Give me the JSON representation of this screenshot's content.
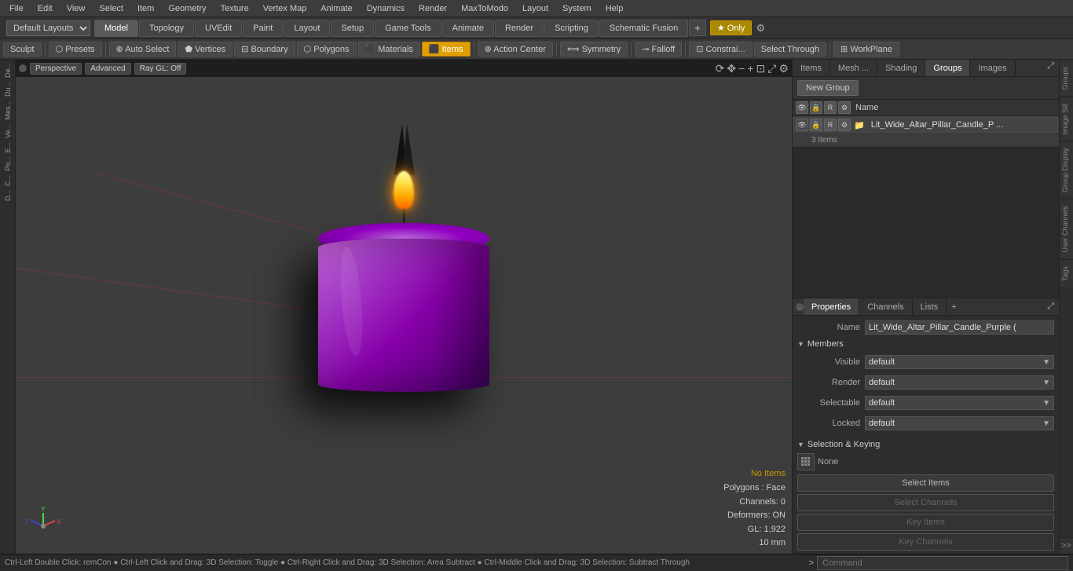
{
  "menubar": {
    "items": [
      "File",
      "Edit",
      "View",
      "Select",
      "Item",
      "Geometry",
      "Texture",
      "Vertex Map",
      "Animate",
      "Dynamics",
      "Render",
      "MaxToModo",
      "Layout",
      "System",
      "Help"
    ]
  },
  "layout_selector": {
    "value": "Default Layouts",
    "label": "Default Layouts ▾"
  },
  "tabs": [
    {
      "label": "Model",
      "active": true
    },
    {
      "label": "Topology",
      "active": false
    },
    {
      "label": "UVEdit",
      "active": false
    },
    {
      "label": "Paint",
      "active": false
    },
    {
      "label": "Layout",
      "active": false
    },
    {
      "label": "Setup",
      "active": false
    },
    {
      "label": "Game Tools",
      "active": false
    },
    {
      "label": "Animate",
      "active": false
    },
    {
      "label": "Render",
      "active": false
    },
    {
      "label": "Scripting",
      "active": false
    },
    {
      "label": "Schematic Fusion",
      "active": false
    }
  ],
  "star_label": "★ Only",
  "plus_label": "+",
  "tools": {
    "sculpt_label": "Sculpt",
    "presets_label": "⬡ Presets",
    "auto_select_label": "⊕ Auto Select",
    "vertices_label": "⬟ Vertices",
    "boundary_label": "⊟ Boundary",
    "polygons_label": "⬡ Polygons",
    "materials_label": "⬛ Materials",
    "items_label": "⬛ Items",
    "action_center_label": "⊕ Action Center",
    "symmetry_label": "⟺ Symmetry",
    "falloff_label": "⊸ Falloff",
    "constraints_label": "⊡ Constrai...",
    "select_through_label": "Select Through",
    "workplane_label": "⊞ WorkPlane"
  },
  "viewport": {
    "mode_label": "Perspective",
    "quality_label": "Advanced",
    "render_label": "Ray GL: Off",
    "status": {
      "no_items": "No Items",
      "polygons": "Polygons : Face",
      "channels": "Channels: 0",
      "deformers": "Deformers: ON",
      "gl": "GL: 1,922",
      "unit": "10 mm"
    }
  },
  "left_sidebar": {
    "items": [
      "De...",
      "Du...",
      "Me...",
      "Ve...",
      "E...",
      "Po...",
      "C...",
      "D..."
    ]
  },
  "right_panel": {
    "tabs": [
      "Items",
      "Mesh ...",
      "Shading",
      "Groups",
      "Images"
    ],
    "active_tab": "Groups",
    "new_group_btn": "New Group",
    "header": {
      "name_col": "Name"
    },
    "group_item": {
      "name": "Lit_Wide_Altar_Pillar_Candle_P ...",
      "sub_count": "3 Items"
    }
  },
  "properties": {
    "tabs": [
      "Properties",
      "Channels",
      "Lists"
    ],
    "active_tab": "Properties",
    "add_btn": "+",
    "name_label": "Name",
    "name_value": "Lit_Wide_Altar_Pillar_Candle_Purple (",
    "sections": {
      "members": "Members",
      "selection_keying": "Selection & Keying"
    },
    "members": {
      "visible_label": "Visible",
      "visible_value": "default",
      "render_label": "Render",
      "render_value": "default",
      "selectable_label": "Selectable",
      "selectable_value": "default",
      "locked_label": "Locked",
      "locked_value": "default"
    },
    "keying": {
      "none_label": "None",
      "select_items_label": "Select Items",
      "select_channels_label": "Select Channels",
      "key_items_label": "Key Items",
      "key_channels_label": "Key Channels"
    }
  },
  "right_vtabs": [
    "Groups",
    "Image Sill",
    "Group Display",
    "User Channels",
    "Tags"
  ],
  "bottom": {
    "status": "Ctrl-Left Double Click: remCon ● Ctrl-Left Click and Drag: 3D Selection: Toggle ● Ctrl-Right Click and Drag: 3D Selection: Area Subtract ● Ctrl-Middle Click and Drag: 3D Selection: Subtract Through",
    "prompt_label": ">",
    "command_placeholder": "Command"
  }
}
